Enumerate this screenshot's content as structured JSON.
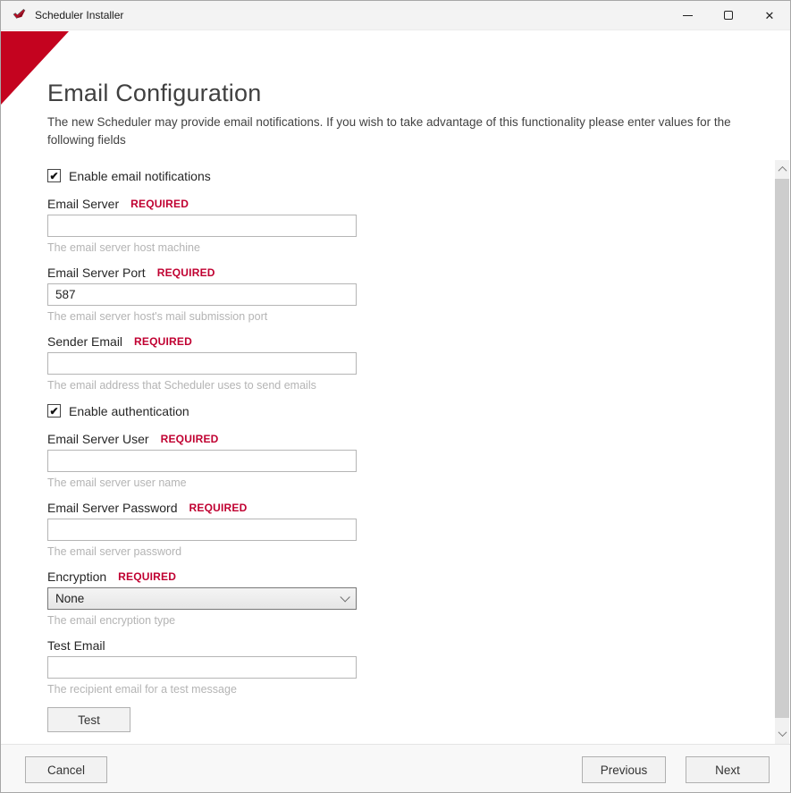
{
  "titlebar": {
    "title": "Scheduler Installer"
  },
  "window_controls": {
    "close_glyph": "✕"
  },
  "header": {
    "title": "Email Configuration",
    "description": "The new Scheduler may provide email notifications.  If you wish to take advantage of this functionality please enter values for the following fields"
  },
  "checkboxes": {
    "notifications": {
      "label": "Enable email notifications",
      "checked": true
    },
    "authentication": {
      "label": "Enable authentication",
      "checked": true
    }
  },
  "glyphs": {
    "check": "✔"
  },
  "fields": [
    {
      "label": "Email Server",
      "required": "REQUIRED",
      "value": "",
      "help": "The email server host machine"
    },
    {
      "label": "Email Server Port",
      "required": "REQUIRED",
      "value": "587",
      "help": "The email server host's mail submission port"
    },
    {
      "label": "Sender Email",
      "required": "REQUIRED",
      "value": "",
      "help": "The email address that Scheduler uses to send emails"
    },
    {
      "label": "Email Server User",
      "required": "REQUIRED",
      "value": "",
      "help": "The email server user name"
    },
    {
      "label": "Email Server Password",
      "required": "REQUIRED",
      "value": "",
      "help": "The email server password"
    },
    {
      "label": "Encryption",
      "required": "REQUIRED",
      "value": "None",
      "help": "The email encryption type"
    },
    {
      "label": "Test Email",
      "required": "",
      "value": "",
      "help": "The recipient email for a test message"
    }
  ],
  "buttons": {
    "test": "Test",
    "cancel": "Cancel",
    "previous": "Previous",
    "next": "Next"
  },
  "colors": {
    "accent_red": "#c4031f",
    "required_red": "#c00031"
  }
}
